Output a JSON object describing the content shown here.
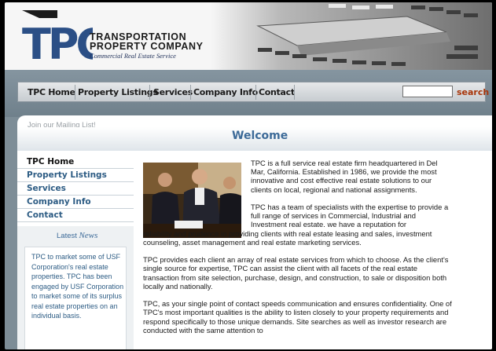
{
  "brand": {
    "logo_text": "TPC",
    "line1": "TRANSPORTATION",
    "line2": "PROPERTY COMPANY",
    "tagline": "Commercial Real Estate Service"
  },
  "nav": {
    "items": [
      "TPC Home",
      "Property Listings",
      "Services",
      "Company Info",
      "Contact"
    ],
    "search_value": "",
    "search_label": "search"
  },
  "mailing_link": "Join our Mailing List!",
  "welcome": "Welcome",
  "side_menu": {
    "items": [
      "TPC Home",
      "Property Listings",
      "Services",
      "Company Info",
      "Contact"
    ]
  },
  "news": {
    "title_prefix": "Latest",
    "title_emph": "News",
    "text": "TPC to market some of USF Corporation's real estate properties. TPC has been engaged by USF Corporation to market some of its surplus real estate properties on an individual basis."
  },
  "main": {
    "p1": "TPC is a full service real estate firm headquartered in Del Mar, California. Established in 1986, we provide the most innovative and cost effective real estate solutions to our clients on local, regional and national assignments.",
    "p2a": "TPC has a team of specialists with the expertise to provide a full range of services in Commercial, Industrial and Investment real estate. we have a reputation for",
    "p2b": "reliability and prudence in providing clients with real estate leasing and sales, investment counseling, asset management and real estate marketing services.",
    "p3": "TPC provides each client an array of real estate services from which to choose. As the client's single source for expertise, TPC can assist the client with all facets of the real estate transaction from site selection, purchase, design, and construction, to sale or disposition both locally and nationally.",
    "p4": "TPC, as your single point of contact speeds communication and ensures confidentiality. One of TPC's most important qualities is the ability to listen closely to your property requirements and respond specifically to those unique demands. Site searches as well as investor research are conducted with the same attention to"
  },
  "colors": {
    "nav_bg": "#7d8d97",
    "link_blue": "#2d5c84",
    "heading_blue": "#3c6a98",
    "search_red": "#a8350a",
    "logo_navy": "#24345c"
  }
}
